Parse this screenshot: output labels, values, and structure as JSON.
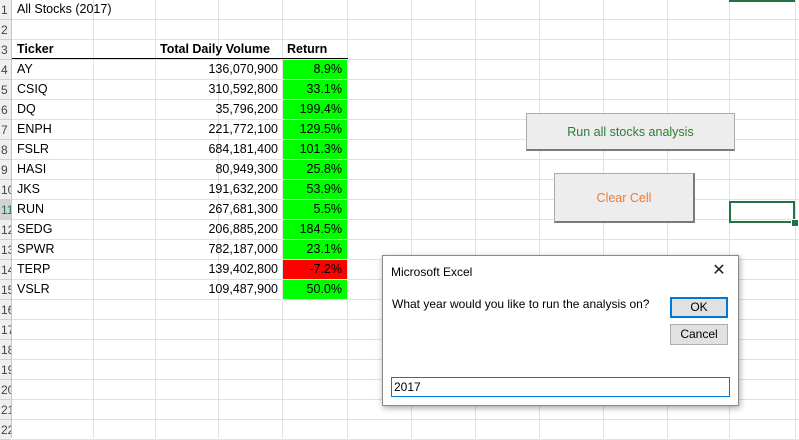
{
  "sheet": {
    "title": "All Stocks (2017)",
    "headers": {
      "ticker": "Ticker",
      "volume": "Total Daily Volume",
      "return": "Return"
    },
    "row_numbers": [
      "1",
      "2",
      "3",
      "4",
      "5",
      "6",
      "7",
      "8",
      "9",
      "10",
      "11",
      "12",
      "13",
      "14",
      "15",
      "16",
      "17",
      "18",
      "19",
      "20",
      "21",
      "22"
    ],
    "rows": [
      {
        "ticker": "AY",
        "volume": "136,070,900",
        "return": "8.9%",
        "status": "positive"
      },
      {
        "ticker": "CSIQ",
        "volume": "310,592,800",
        "return": "33.1%",
        "status": "positive"
      },
      {
        "ticker": "DQ",
        "volume": "35,796,200",
        "return": "199.4%",
        "status": "positive"
      },
      {
        "ticker": "ENPH",
        "volume": "221,772,100",
        "return": "129.5%",
        "status": "positive"
      },
      {
        "ticker": "FSLR",
        "volume": "684,181,400",
        "return": "101.3%",
        "status": "positive"
      },
      {
        "ticker": "HASI",
        "volume": "80,949,300",
        "return": "25.8%",
        "status": "positive"
      },
      {
        "ticker": "JKS",
        "volume": "191,632,200",
        "return": "53.9%",
        "status": "positive"
      },
      {
        "ticker": "RUN",
        "volume": "267,681,300",
        "return": "5.5%",
        "status": "positive"
      },
      {
        "ticker": "SEDG",
        "volume": "206,885,200",
        "return": "184.5%",
        "status": "positive"
      },
      {
        "ticker": "SPWR",
        "volume": "782,187,000",
        "return": "23.1%",
        "status": "positive"
      },
      {
        "ticker": "TERP",
        "volume": "139,402,800",
        "return": "-7.2%",
        "status": "negative"
      },
      {
        "ticker": "VSLR",
        "volume": "109,487,900",
        "return": "50.0%",
        "status": "positive"
      }
    ],
    "colors": {
      "positive": "#00ff00",
      "negative": "#ff0000",
      "accent": "#217346"
    }
  },
  "buttons": {
    "run_label": "Run all stocks analysis",
    "clear_label": "Clear Cell",
    "run_color": "#2e7d32",
    "clear_color": "#ed7d31"
  },
  "dialog": {
    "title": "Microsoft Excel",
    "close_icon": "close-icon",
    "prompt": "What year would you like to run the analysis on?",
    "ok_label": "OK",
    "cancel_label": "Cancel",
    "input_value": "2017"
  }
}
